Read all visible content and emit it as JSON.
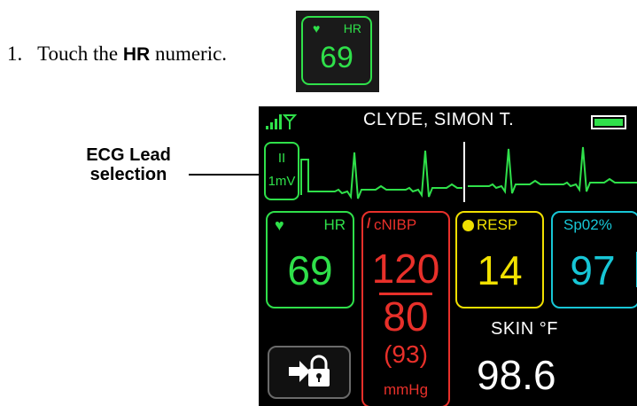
{
  "instruction": {
    "number": "1.",
    "prefix": "Touch the",
    "bold": "HR",
    "suffix": "numeric."
  },
  "inset": {
    "label": "HR",
    "value": "69",
    "icon": "heart-icon"
  },
  "callout": {
    "line1": "ECG Lead",
    "line2": "selection"
  },
  "monitor": {
    "patient_name": "CLYDE, SIMON T.",
    "signal_icon": "signal-antenna-icon",
    "battery_icon": "battery-icon",
    "ecg_lead": {
      "lead": "II",
      "scale": "1mV"
    },
    "hr": {
      "label": "HR",
      "value": "69",
      "icon": "heart-icon",
      "color": "#2fe04a"
    },
    "nibp": {
      "label": "cNIBP",
      "systolic": "120",
      "diastolic": "80",
      "mean": "(93)",
      "unit": "mmHg",
      "color": "#e8302a"
    },
    "resp": {
      "label": "RESP",
      "value": "14",
      "color": "#f0e000"
    },
    "spo2": {
      "label": "Sp02%",
      "value": "97",
      "color": "#17c6d6"
    },
    "skin": {
      "label": "SKIN °F",
      "value": "98.6"
    },
    "lock_button_icon": "screen-lock-icon"
  }
}
